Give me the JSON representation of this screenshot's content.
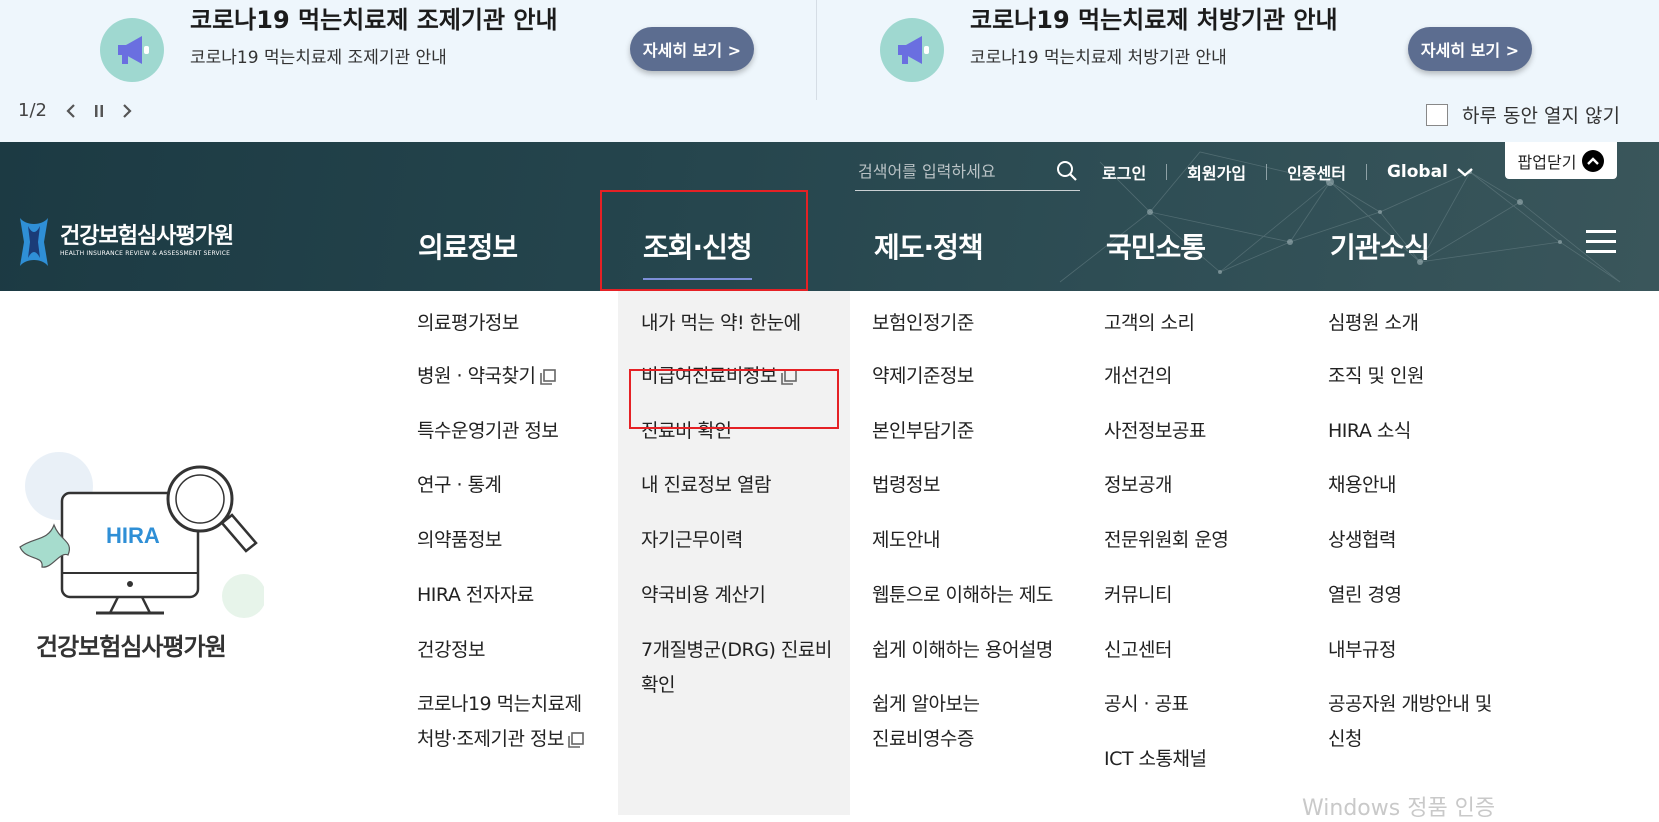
{
  "popup": {
    "cards": [
      {
        "title": "코로나19 먹는치료제 조제기관 안내",
        "subtitle": "코로나19 먹는치료제 조제기관 안내",
        "button": "자세히 보기 >"
      },
      {
        "title": "코로나19 먹는치료제 처방기관 안내",
        "subtitle": "코로나19 먹는치료제 처방기관 안내",
        "button": "자세히 보기 >"
      }
    ],
    "pager": "1/2",
    "dont_show_today": "하루 동안 열지 않기",
    "close_label": "팝업닫기"
  },
  "header": {
    "search_placeholder": "검색어를 입력하세요",
    "links": [
      "로그인",
      "회원가입",
      "인증센터"
    ],
    "global": "Global",
    "logo_ko": "건강보험심사평가원",
    "logo_en": "HEALTH INSURANCE REVIEW & ASSESSMENT SERVICE",
    "gnb": [
      "의료정보",
      "조회·신청",
      "제도·정책",
      "국민소통",
      "기관소식"
    ]
  },
  "mega": {
    "illustration_label": "HIRA",
    "org_name": "건강보험심사평가원",
    "col1": [
      "의료평가정보",
      "병원 · 약국찾기",
      "특수운영기관 정보",
      "연구 · 통계",
      "의약품정보",
      "HIRA 전자자료",
      "건강정보",
      "코로나19 먹는치료제",
      "처방·조제기관 정보"
    ],
    "col2": [
      "내가 먹는 약! 한눈에",
      "비급여진료비정보",
      "진료비 확인",
      "내 진료정보 열람",
      "자기근무이력",
      "약국비용 계산기",
      "7개질병군(DRG) 진료비",
      "확인"
    ],
    "col3": [
      "보험인정기준",
      "약제기준정보",
      "본인부담기준",
      "법령정보",
      "제도안내",
      "웹툰으로 이해하는 제도",
      "쉽게 이해하는 용어설명",
      "쉽게 알아보는",
      "진료비영수증"
    ],
    "col4": [
      "고객의 소리",
      "개선건의",
      "사전정보공표",
      "정보공개",
      "전문위원회 운영",
      "커뮤니티",
      "신고센터",
      "공시 · 공표",
      "ICT 소통채널"
    ],
    "col5": [
      "심평원 소개",
      "조직 및 인원",
      "HIRA 소식",
      "채용안내",
      "상생협력",
      "열린 경영",
      "내부규정",
      "공공자원 개방안내 및",
      "신청"
    ]
  },
  "watermark": "Windows 정품 인증",
  "colors": {
    "header_bg": "#25454d",
    "button_bg": "#5c6d90",
    "highlight": "#e52125",
    "popup_bg": "#eef6fc"
  }
}
